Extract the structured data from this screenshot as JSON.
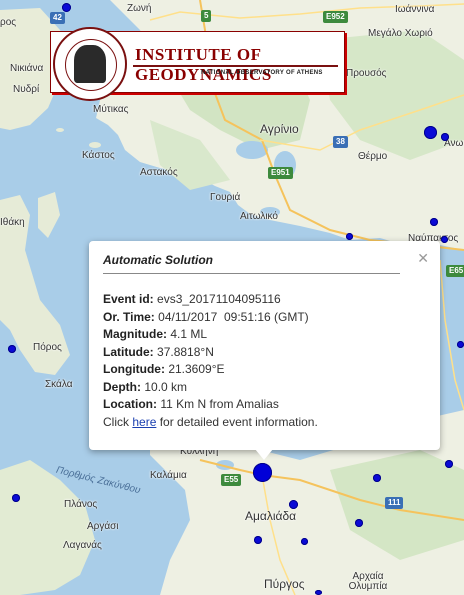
{
  "logo": {
    "title": "INSTITUTE OF GEODYNAMICS",
    "subtitle": "NATIONAL OBSERVATORY OF ATHENS"
  },
  "map_labels": {
    "zoni": "Ζωνή",
    "ioannina": "Ιωάννινα",
    "megalo_horio": "Μεγάλο Χωριό",
    "nikiana": "Νικιάνα",
    "nydri": "Νυδρί",
    "prousos": "Προυσός",
    "mytikas": "Μύτικας",
    "agrinio": "Αγρίνιο",
    "thermo": "Θέρμο",
    "kastos": "Κάστος",
    "astakos": "Αστακός",
    "gouria": "Γουριά",
    "aitoliko": "Αιτωλικό",
    "ithaki": "Ιθάκη",
    "nafpaktos": "Ναύπακτος",
    "poros": "Πόρος",
    "poros2": "ρος",
    "skala": "Σκάλα",
    "kyllini": "Κυλλήνη",
    "gulf_zakynthos": "Πορθμός Ζακύνθου",
    "kalamia": "Καλάμια",
    "planos": "Πλάνος",
    "argasi": "Αργάσι",
    "laganas": "Λαγανάς",
    "amaliada": "Αμαλιάδα",
    "pyrgos": "Πύργος",
    "archaia_olympia": "Αρχαία Ολυμπία",
    "ano": "Ανω"
  },
  "road_shields": {
    "r42": "42",
    "r5a": "5",
    "e952": "E952",
    "r38": "38",
    "e951": "E951",
    "e65": "E65",
    "e55": "E55",
    "r111": "111"
  },
  "popup": {
    "title": "Automatic Solution",
    "close": "✕",
    "event_id_label": "Event id:",
    "event_id": "evs3_20171104095116",
    "or_time_label": "Or. Time:",
    "or_time": "04/11/2017  09:51:16 (GMT)",
    "magnitude_label": "Magnitude:",
    "magnitude": "4.1 ML",
    "latitude_label": "Latitude:",
    "latitude": "37.8818°N",
    "longitude_label": "Longitude:",
    "longitude": "21.3609°E",
    "depth_label": "Depth:",
    "depth": "10.0 km",
    "location_label": "Location:",
    "location": "11 Km N from Amalias",
    "click_prefix": "Click ",
    "link_text": "here",
    "click_suffix": " for detailed event information."
  },
  "colors": {
    "sea": "#a9cde8",
    "land": "#f2efe6",
    "marker": "#0000d8",
    "logo_red": "#8a0000"
  }
}
